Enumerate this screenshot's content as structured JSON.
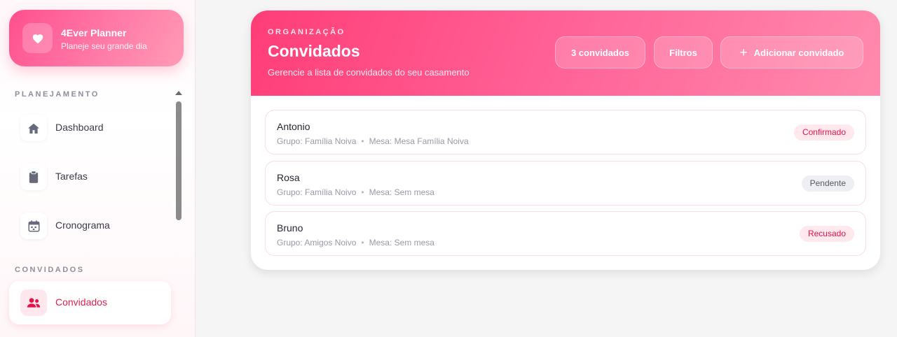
{
  "brand": {
    "title": "4Ever Planner",
    "subtitle": "Planeje seu grande dia",
    "icon": "heart-icon"
  },
  "sidebar": {
    "sections": [
      {
        "label": "PLANEJAMENTO",
        "items": [
          {
            "label": "Dashboard",
            "icon": "home-icon"
          },
          {
            "label": "Tarefas",
            "icon": "clipboard-icon"
          },
          {
            "label": "Cronograma",
            "icon": "calendar-icon"
          }
        ]
      },
      {
        "label": "CONVIDADOS",
        "items": [
          {
            "label": "Convidados",
            "icon": "users-icon",
            "active": true
          }
        ]
      }
    ]
  },
  "header": {
    "eyebrow": "ORGANIZAÇÃO",
    "title": "Convidados",
    "subtitle": "Gerencie a lista de convidados do seu casamento",
    "count_button": "3 convidados",
    "filter_button": "Filtros",
    "add_button": "Adicionar convidado"
  },
  "guests": [
    {
      "name": "Antonio",
      "group": "Grupo: Família Noiva",
      "table": "Mesa: Mesa Família Noiva",
      "status": "Confirmado"
    },
    {
      "name": "Rosa",
      "group": "Grupo: Família Noivo",
      "table": "Mesa: Sem mesa",
      "status": "Pendente"
    },
    {
      "name": "Bruno",
      "group": "Grupo: Amigos Noivo",
      "table": "Mesa: Sem mesa",
      "status": "Recusado"
    }
  ],
  "colors": {
    "accent": "#ff3d77",
    "accent_light": "#ff8aae",
    "status_confirmed": "#e3134a",
    "status_pending": "#555866",
    "status_refused": "#e3134a"
  }
}
